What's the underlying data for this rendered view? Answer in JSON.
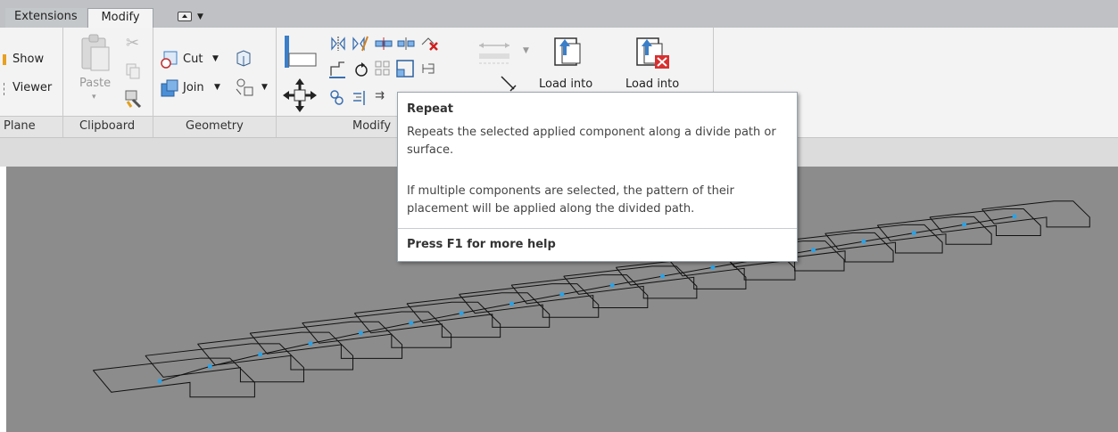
{
  "tabs": {
    "extensions": "Extensions",
    "modify": "Modify"
  },
  "ribbon": {
    "show_label": "Show",
    "viewer_label": "Viewer",
    "paste_label": "Paste",
    "cut_label": "Cut",
    "join_label": "Join",
    "load_into_1": "Load into",
    "load_into_2": "Load into"
  },
  "panels": {
    "plane": "Plane",
    "clipboard": "Clipboard",
    "geometry": "Geometry",
    "modify": "Modify"
  },
  "tooltip": {
    "title": "Repeat",
    "description": "Repeats the selected applied component along a divide path or surface.",
    "details": "If multiple components are selected, the pattern of their placement will be applied along the divided path.",
    "help": "Press F1 for more help"
  },
  "colors": {
    "accent": "#2a7fd4",
    "node": "#29a3e8",
    "viewport": "#8c8c8c"
  }
}
